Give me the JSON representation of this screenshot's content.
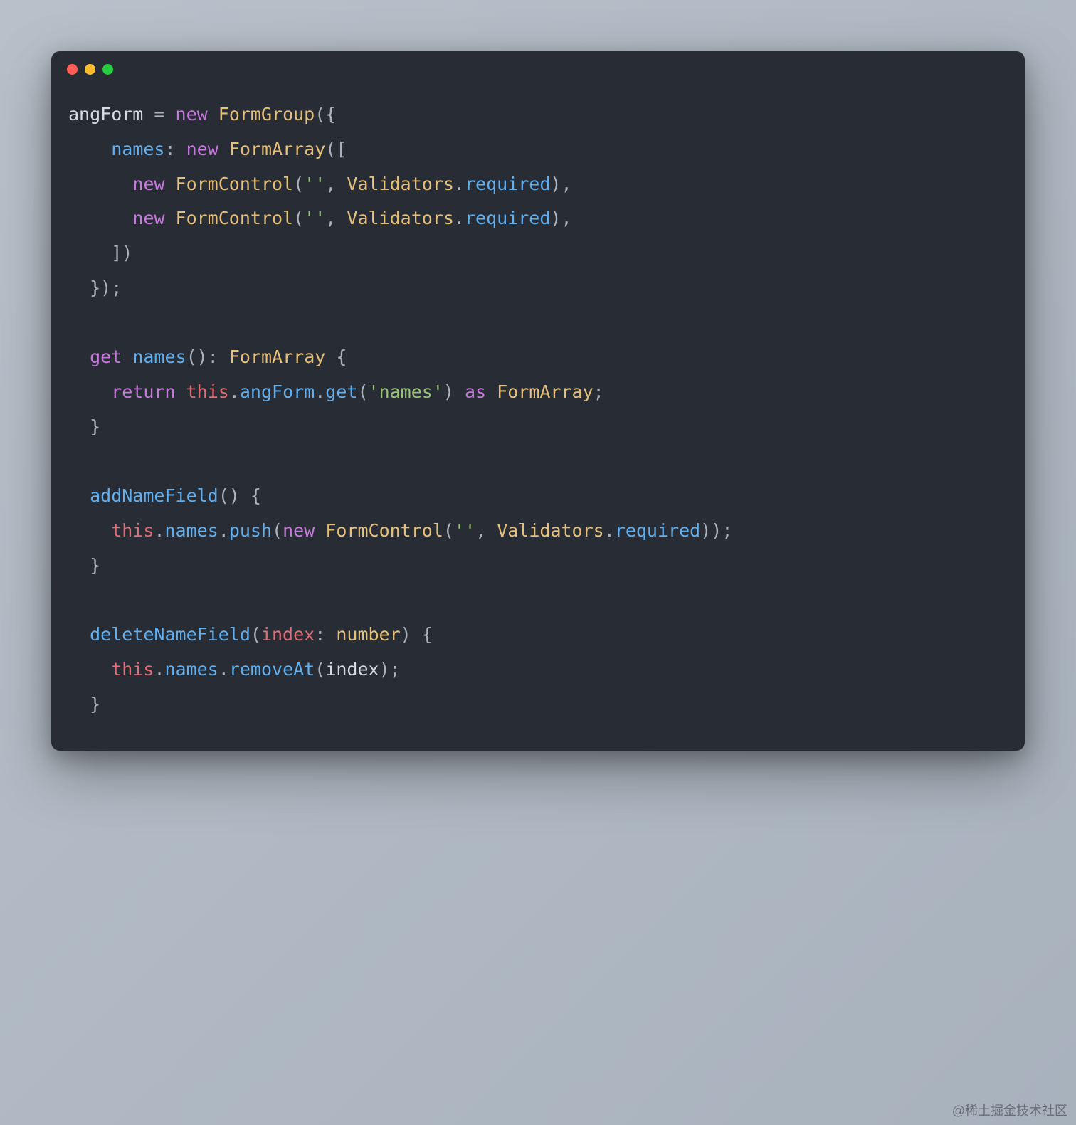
{
  "watermark": "@稀土掘金技术社区",
  "code": {
    "tokens": [
      [
        {
          "t": "angForm",
          "c": "ident"
        },
        {
          "t": " ",
          "c": "op"
        },
        {
          "t": "=",
          "c": "op"
        },
        {
          "t": " ",
          "c": "op"
        },
        {
          "t": "new",
          "c": "keyword"
        },
        {
          "t": " ",
          "c": "op"
        },
        {
          "t": "FormGroup",
          "c": "class"
        },
        {
          "t": "(",
          "c": "punct"
        },
        {
          "t": "{",
          "c": "punct"
        }
      ],
      [
        {
          "t": "    ",
          "c": "op"
        },
        {
          "t": "names",
          "c": "prop"
        },
        {
          "t": ":",
          "c": "punct"
        },
        {
          "t": " ",
          "c": "op"
        },
        {
          "t": "new",
          "c": "keyword"
        },
        {
          "t": " ",
          "c": "op"
        },
        {
          "t": "FormArray",
          "c": "class"
        },
        {
          "t": "(",
          "c": "punct"
        },
        {
          "t": "[",
          "c": "punct"
        }
      ],
      [
        {
          "t": "      ",
          "c": "op"
        },
        {
          "t": "new",
          "c": "keyword"
        },
        {
          "t": " ",
          "c": "op"
        },
        {
          "t": "FormControl",
          "c": "class"
        },
        {
          "t": "(",
          "c": "punct"
        },
        {
          "t": "''",
          "c": "string"
        },
        {
          "t": ",",
          "c": "punct"
        },
        {
          "t": " ",
          "c": "op"
        },
        {
          "t": "Validators",
          "c": "class"
        },
        {
          "t": ".",
          "c": "punct"
        },
        {
          "t": "required",
          "c": "member"
        },
        {
          "t": ")",
          "c": "punct"
        },
        {
          "t": ",",
          "c": "punct"
        }
      ],
      [
        {
          "t": "      ",
          "c": "op"
        },
        {
          "t": "new",
          "c": "keyword"
        },
        {
          "t": " ",
          "c": "op"
        },
        {
          "t": "FormControl",
          "c": "class"
        },
        {
          "t": "(",
          "c": "punct"
        },
        {
          "t": "''",
          "c": "string"
        },
        {
          "t": ",",
          "c": "punct"
        },
        {
          "t": " ",
          "c": "op"
        },
        {
          "t": "Validators",
          "c": "class"
        },
        {
          "t": ".",
          "c": "punct"
        },
        {
          "t": "required",
          "c": "member"
        },
        {
          "t": ")",
          "c": "punct"
        },
        {
          "t": ",",
          "c": "punct"
        }
      ],
      [
        {
          "t": "    ",
          "c": "op"
        },
        {
          "t": "]",
          "c": "punct"
        },
        {
          "t": ")",
          "c": "punct"
        }
      ],
      [
        {
          "t": "  ",
          "c": "op"
        },
        {
          "t": "}",
          "c": "punct"
        },
        {
          "t": ")",
          "c": "punct"
        },
        {
          "t": ";",
          "c": "punct"
        }
      ],
      [],
      [
        {
          "t": "  ",
          "c": "op"
        },
        {
          "t": "get",
          "c": "keyword"
        },
        {
          "t": " ",
          "c": "op"
        },
        {
          "t": "names",
          "c": "func"
        },
        {
          "t": "(",
          "c": "punct"
        },
        {
          "t": ")",
          "c": "punct"
        },
        {
          "t": ":",
          "c": "punct"
        },
        {
          "t": " ",
          "c": "op"
        },
        {
          "t": "FormArray",
          "c": "class"
        },
        {
          "t": " ",
          "c": "op"
        },
        {
          "t": "{",
          "c": "punct"
        }
      ],
      [
        {
          "t": "    ",
          "c": "op"
        },
        {
          "t": "return",
          "c": "keyword"
        },
        {
          "t": " ",
          "c": "op"
        },
        {
          "t": "this",
          "c": "this"
        },
        {
          "t": ".",
          "c": "punct"
        },
        {
          "t": "angForm",
          "c": "member"
        },
        {
          "t": ".",
          "c": "punct"
        },
        {
          "t": "get",
          "c": "func"
        },
        {
          "t": "(",
          "c": "punct"
        },
        {
          "t": "'names'",
          "c": "string"
        },
        {
          "t": ")",
          "c": "punct"
        },
        {
          "t": " ",
          "c": "op"
        },
        {
          "t": "as",
          "c": "keyword"
        },
        {
          "t": " ",
          "c": "op"
        },
        {
          "t": "FormArray",
          "c": "class"
        },
        {
          "t": ";",
          "c": "punct"
        }
      ],
      [
        {
          "t": "  ",
          "c": "op"
        },
        {
          "t": "}",
          "c": "punct"
        }
      ],
      [],
      [
        {
          "t": "  ",
          "c": "op"
        },
        {
          "t": "addNameField",
          "c": "func"
        },
        {
          "t": "(",
          "c": "punct"
        },
        {
          "t": ")",
          "c": "punct"
        },
        {
          "t": " ",
          "c": "op"
        },
        {
          "t": "{",
          "c": "punct"
        }
      ],
      [
        {
          "t": "    ",
          "c": "op"
        },
        {
          "t": "this",
          "c": "this"
        },
        {
          "t": ".",
          "c": "punct"
        },
        {
          "t": "names",
          "c": "member"
        },
        {
          "t": ".",
          "c": "punct"
        },
        {
          "t": "push",
          "c": "func"
        },
        {
          "t": "(",
          "c": "punct"
        },
        {
          "t": "new",
          "c": "keyword"
        },
        {
          "t": " ",
          "c": "op"
        },
        {
          "t": "FormControl",
          "c": "class"
        },
        {
          "t": "(",
          "c": "punct"
        },
        {
          "t": "''",
          "c": "string"
        },
        {
          "t": ",",
          "c": "punct"
        },
        {
          "t": " ",
          "c": "op"
        },
        {
          "t": "Validators",
          "c": "class"
        },
        {
          "t": ".",
          "c": "punct"
        },
        {
          "t": "required",
          "c": "member"
        },
        {
          "t": ")",
          "c": "punct"
        },
        {
          "t": ")",
          "c": "punct"
        },
        {
          "t": ";",
          "c": "punct"
        }
      ],
      [
        {
          "t": "  ",
          "c": "op"
        },
        {
          "t": "}",
          "c": "punct"
        }
      ],
      [],
      [
        {
          "t": "  ",
          "c": "op"
        },
        {
          "t": "deleteNameField",
          "c": "func"
        },
        {
          "t": "(",
          "c": "punct"
        },
        {
          "t": "index",
          "c": "param"
        },
        {
          "t": ":",
          "c": "punct"
        },
        {
          "t": " ",
          "c": "op"
        },
        {
          "t": "number",
          "c": "class"
        },
        {
          "t": ")",
          "c": "punct"
        },
        {
          "t": " ",
          "c": "op"
        },
        {
          "t": "{",
          "c": "punct"
        }
      ],
      [
        {
          "t": "    ",
          "c": "op"
        },
        {
          "t": "this",
          "c": "this"
        },
        {
          "t": ".",
          "c": "punct"
        },
        {
          "t": "names",
          "c": "member"
        },
        {
          "t": ".",
          "c": "punct"
        },
        {
          "t": "removeAt",
          "c": "func"
        },
        {
          "t": "(",
          "c": "punct"
        },
        {
          "t": "index",
          "c": "ident"
        },
        {
          "t": ")",
          "c": "punct"
        },
        {
          "t": ";",
          "c": "punct"
        }
      ],
      [
        {
          "t": "  ",
          "c": "op"
        },
        {
          "t": "}",
          "c": "punct"
        }
      ]
    ]
  }
}
